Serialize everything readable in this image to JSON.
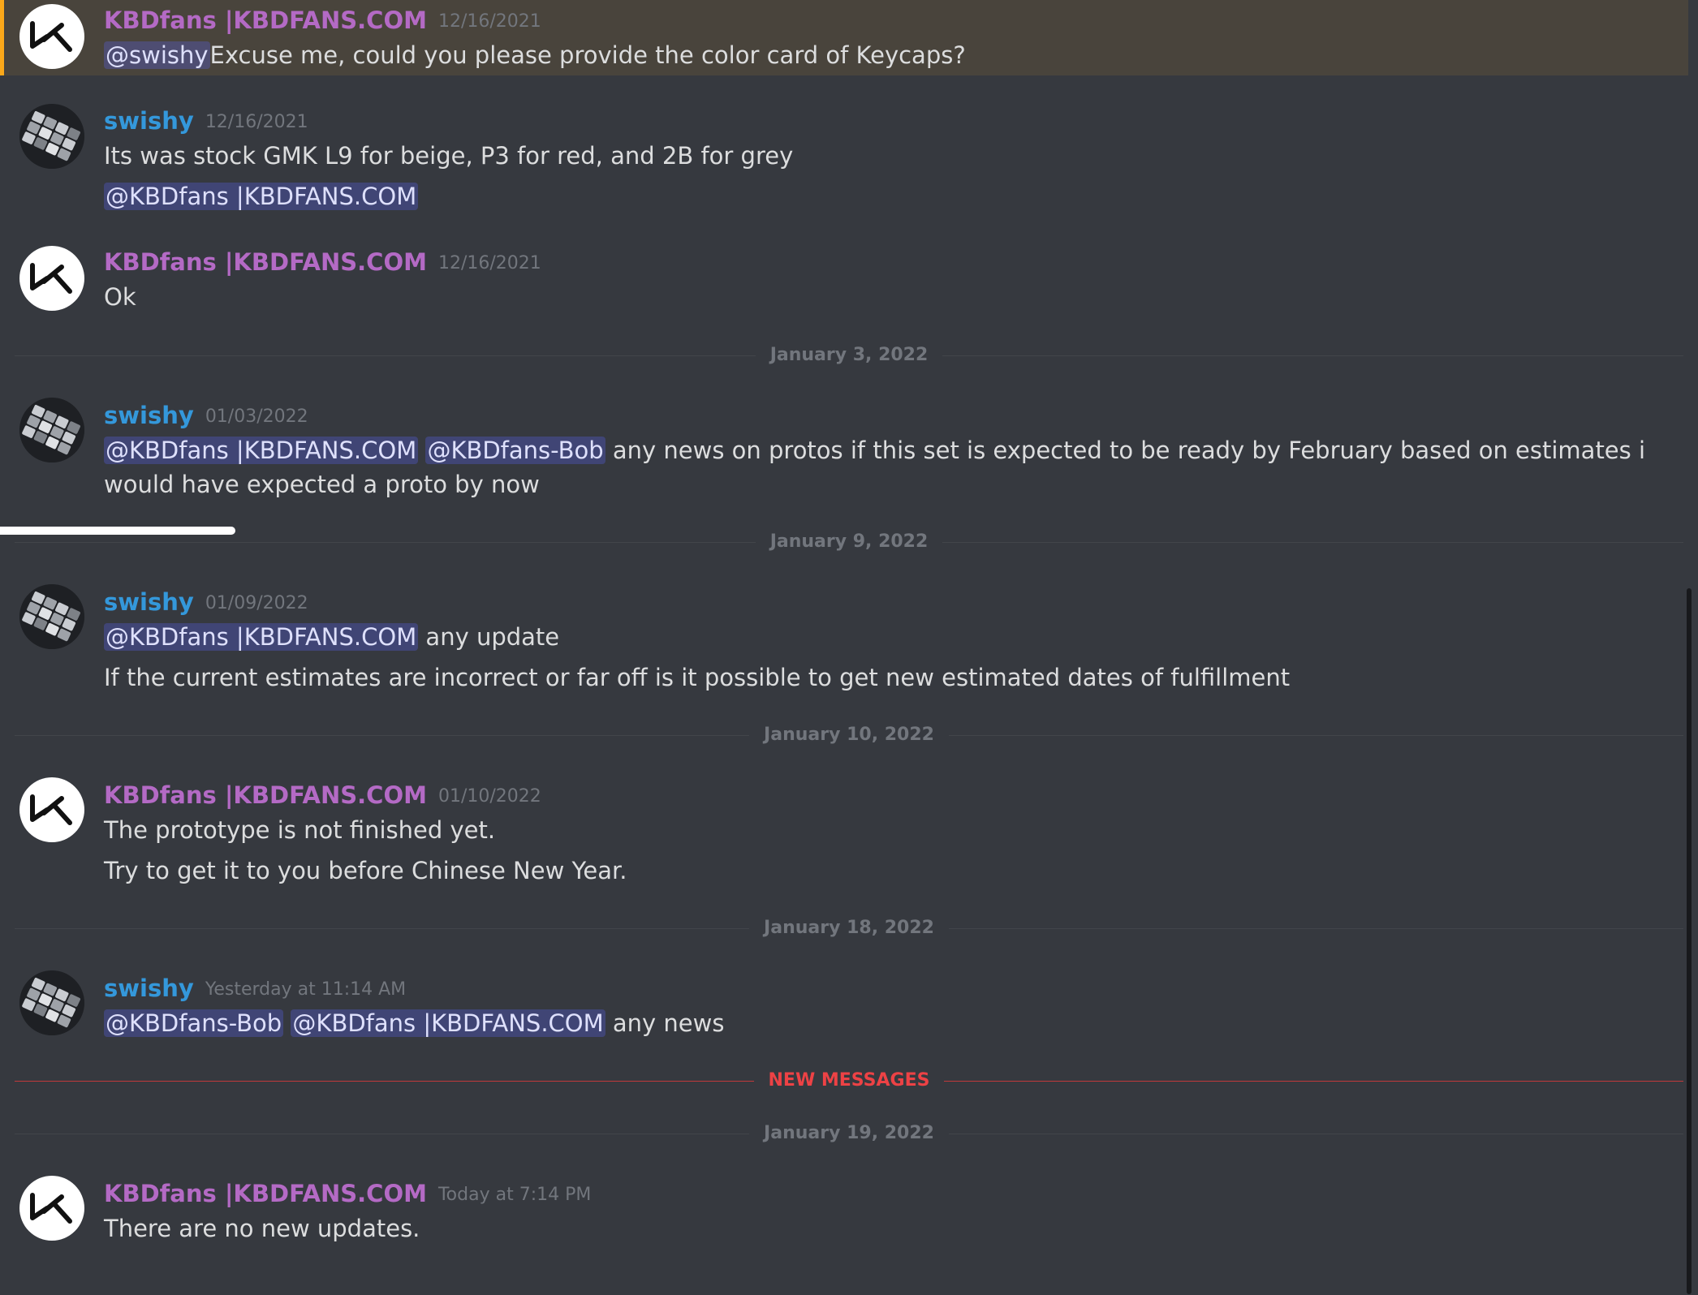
{
  "colors": {
    "background": "#36393f",
    "highlight_bg": "#49443c",
    "highlight_border": "#faa81a",
    "kbd_author": "#b46ac5",
    "swishy_author": "#3498db",
    "new_messages": "#ed4245"
  },
  "messages": [
    {
      "author": "KBDfans |KBDFANS.COM",
      "timestamp": "12/16/2021",
      "avatar_icon": "kbdfans-logo-icon",
      "line1": {
        "mention": "@swishy",
        "text": "Excuse me, could you please provide the color card of Keycaps?"
      }
    },
    {
      "author": "swishy",
      "timestamp": "12/16/2021",
      "avatar_icon": "keyboard-photo-avatar",
      "line1": {
        "text": "Its was stock GMK L9 for beige, P3 for red, and 2B for grey"
      },
      "line2": {
        "mention": "@KBDfans |KBDFANS.COM"
      }
    },
    {
      "author": "KBDfans |KBDFANS.COM",
      "timestamp": "12/16/2021",
      "avatar_icon": "kbdfans-logo-icon",
      "line1": {
        "text": "Ok"
      }
    },
    {
      "author": "swishy",
      "timestamp": "01/03/2022",
      "avatar_icon": "keyboard-photo-avatar",
      "line1": {
        "mention1": "@KBDfans |KBDFANS.COM",
        "mention2": "@KBDfans-Bob",
        "text": " any news on protos if this set is expected to be ready by February based on estimates i would have expected a proto by now"
      }
    },
    {
      "author": "swishy",
      "timestamp": "01/09/2022",
      "avatar_icon": "keyboard-photo-avatar",
      "line1": {
        "mention": "@KBDfans |KBDFANS.COM",
        "text": " any update"
      },
      "line2": {
        "text": "If the current estimates are incorrect or far off is it possible to get new estimated dates of fulfillment"
      }
    },
    {
      "author": "KBDfans |KBDFANS.COM",
      "timestamp": "01/10/2022",
      "avatar_icon": "kbdfans-logo-icon",
      "line1": {
        "text": "The prototype is not finished yet."
      },
      "line2": {
        "text": "Try to get it to you before Chinese New Year."
      }
    },
    {
      "author": "swishy",
      "timestamp": "Yesterday at 11:14 AM",
      "avatar_icon": "keyboard-photo-avatar",
      "line1": {
        "mention1": "@KBDfans-Bob",
        "mention2": "@KBDfans |KBDFANS.COM",
        "text": " any news"
      }
    },
    {
      "author": "KBDfans |KBDFANS.COM",
      "timestamp": "Today at 7:14 PM",
      "avatar_icon": "kbdfans-logo-icon",
      "line1": {
        "text": "There are no new updates."
      }
    }
  ],
  "dividers": {
    "jan3": "January 3, 2022",
    "jan9": "January 9, 2022",
    "jan10": "January 10, 2022",
    "jan18": "January 18, 2022",
    "new_messages": "NEW MESSAGES",
    "jan19": "January 19, 2022"
  }
}
